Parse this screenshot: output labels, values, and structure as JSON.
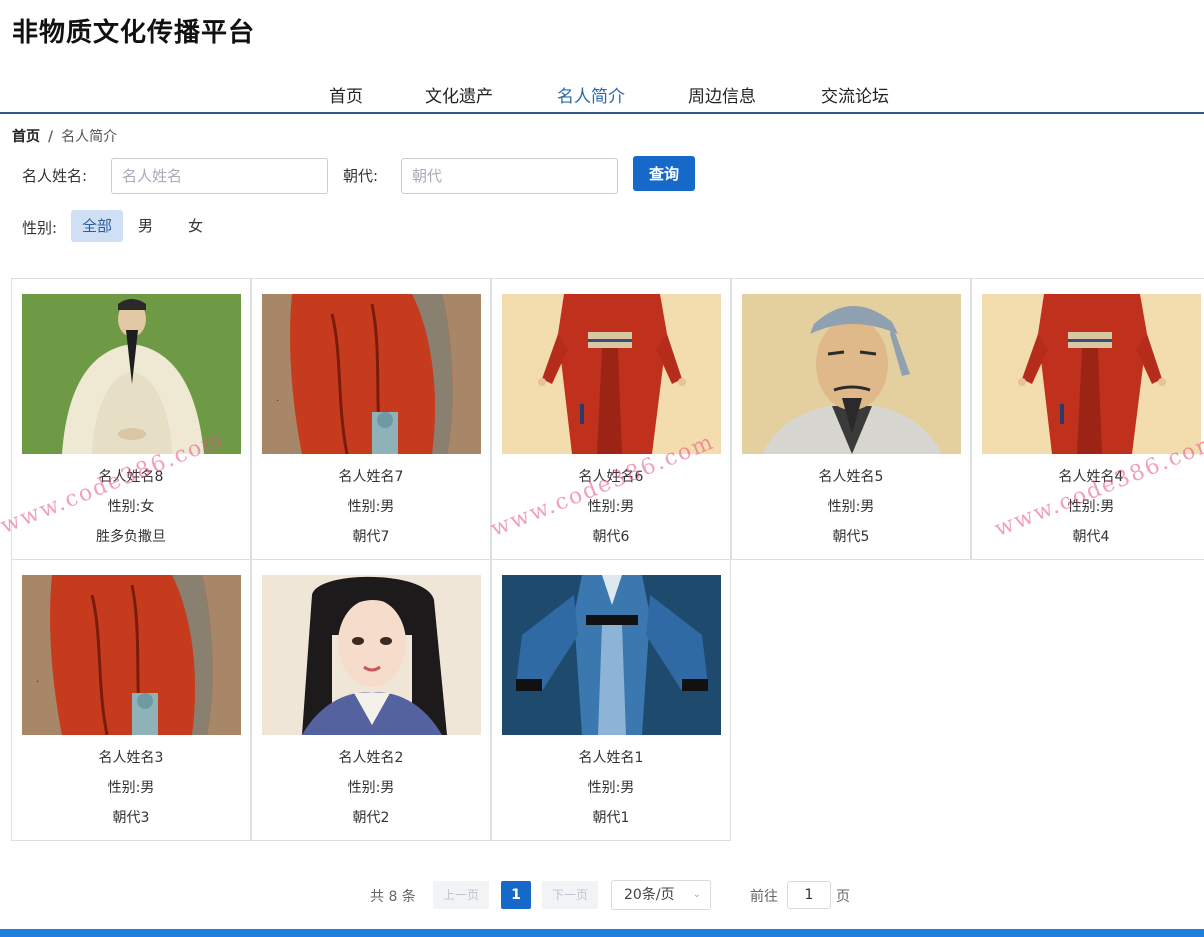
{
  "site": {
    "title": "非物质文化传播平台"
  },
  "nav": {
    "items": [
      {
        "label": "首页"
      },
      {
        "label": "文化遗产"
      },
      {
        "label": "名人简介",
        "active": true
      },
      {
        "label": "周边信息"
      },
      {
        "label": "交流论坛"
      }
    ]
  },
  "breadcrumb": {
    "home": "首页",
    "separator": "/",
    "current": "名人简介"
  },
  "search": {
    "name_label": "名人姓名:",
    "name_placeholder": "名人姓名",
    "name_value": "",
    "dynasty_label": "朝代:",
    "dynasty_placeholder": "朝代",
    "dynasty_value": "",
    "query_label": "查询"
  },
  "gender_filter": {
    "label": "性别:",
    "options": [
      {
        "label": "全部",
        "active": true
      },
      {
        "label": "男"
      },
      {
        "label": "女"
      }
    ]
  },
  "cards": [
    {
      "name": "名人姓名8",
      "gender": "性别:女",
      "dynasty": "胜多负撒旦",
      "image": "elder-white-robe-portrait"
    },
    {
      "name": "名人姓名7",
      "gender": "性别:男",
      "dynasty": "朝代7",
      "image": "red-robe-detail-painting"
    },
    {
      "name": "名人姓名6",
      "gender": "性别:男",
      "dynasty": "朝代6",
      "image": "red-hanfu-figure"
    },
    {
      "name": "名人姓名5",
      "gender": "性别:男",
      "dynasty": "朝代5",
      "image": "scholar-head-portrait"
    },
    {
      "name": "名人姓名4",
      "gender": "性别:男",
      "dynasty": "朝代4",
      "image": "red-hanfu-figure"
    },
    {
      "name": "名人姓名3",
      "gender": "性别:男",
      "dynasty": "朝代3",
      "image": "red-robe-detail-painting"
    },
    {
      "name": "名人姓名2",
      "gender": "性别:男",
      "dynasty": "朝代2",
      "image": "lady-portrait"
    },
    {
      "name": "名人姓名1",
      "gender": "性别:男",
      "dynasty": "朝代1",
      "image": "blue-hanfu-robe"
    }
  ],
  "watermark": {
    "text": "www.code386.com"
  },
  "pagination": {
    "total": "共 8 条",
    "prev": "上一页",
    "current_page": "1",
    "next": "下一页",
    "page_size": "20条/页",
    "goto_label": "前往",
    "goto_value": "1",
    "page_suffix": "页"
  },
  "colors": {
    "primary": "#1769c9",
    "nav_active": "#2a6aa8",
    "nav_border": "#2c5a8a",
    "footer": "#1f7fe0"
  }
}
